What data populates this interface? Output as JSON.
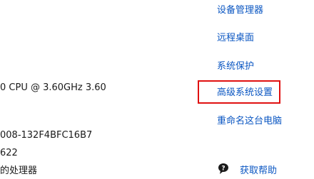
{
  "system_info": {
    "processor_line": "0 CPU @ 3.60GHz   3.60",
    "product_id_line": "008-132F4BFC16B7",
    "number_line": "622",
    "processor_note": "的处理器"
  },
  "related_links": {
    "device_manager": "设备管理器",
    "remote_desktop": "远程桌面",
    "system_protection": "系统保护",
    "advanced_settings": "高级系统设置",
    "rename_pc": "重命名这台电脑",
    "get_help": "获取帮助"
  },
  "colors": {
    "link": "#0a56c2",
    "highlight": "#e01010",
    "text": "#1a1a1a"
  },
  "icons": {
    "help": "help-chat-bubble-icon"
  }
}
